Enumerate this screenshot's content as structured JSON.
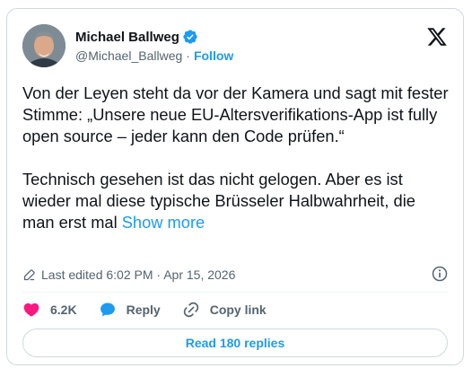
{
  "author": {
    "display_name": "Michael Ballweg",
    "handle": "@Michael_Ballweg",
    "separator": "·",
    "follow_label": "Follow",
    "verified": true
  },
  "tweet": {
    "paragraph1": "Von der Leyen steht da vor der Kamera und sagt mit fester Stimme: „Unsere neue EU-Altersverifikations-App ist fully open source – jeder kann den Code prüfen.“",
    "paragraph2": "Technisch gesehen ist das nicht gelogen. Aber es ist wieder mal diese typische Brüsseler Halbwahrheit, die man erst mal ",
    "show_more_label": "Show more"
  },
  "meta": {
    "edited_label": "Last edited 6:02 PM · Apr 15, 2026"
  },
  "actions": {
    "like_count": "6.2K",
    "reply_label": "Reply",
    "copy_link_label": "Copy link"
  },
  "replies": {
    "read_label": "Read 180 replies"
  },
  "colors": {
    "accent": "#1d9bf0",
    "like": "#f91880",
    "text": "#0f1419",
    "secondary": "#536471",
    "border": "#cfd9de"
  },
  "icons": {
    "verified": "verified-badge-icon",
    "logo": "x-logo-icon",
    "edit": "pencil-icon",
    "info": "info-icon",
    "like": "heart-icon",
    "reply": "speech-bubble-icon",
    "copy_link": "link-icon"
  }
}
